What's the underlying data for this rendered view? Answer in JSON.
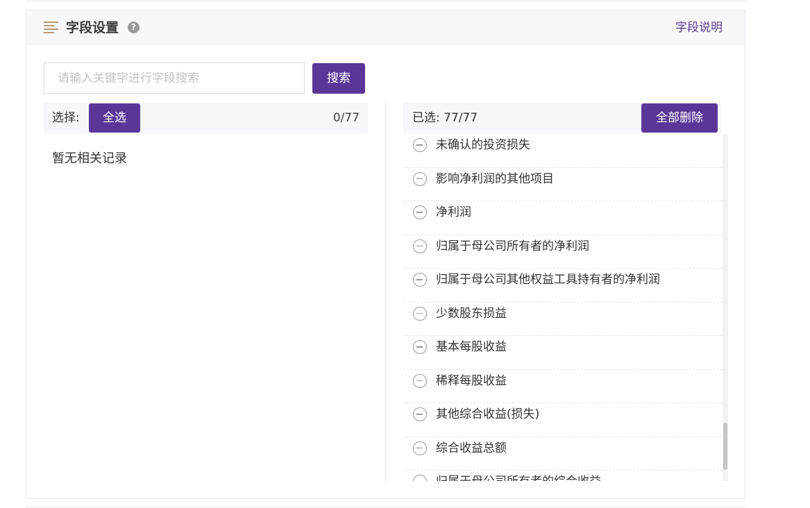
{
  "header": {
    "title": "字段设置",
    "help_glyph": "?",
    "link": "字段说明"
  },
  "search": {
    "placeholder": "请输入关键字进行字段搜索",
    "value": "",
    "button": "搜索"
  },
  "left_panel": {
    "label": "选择:",
    "select_all": "全选",
    "count": "0/77",
    "empty": "暂无相关记录"
  },
  "right_panel": {
    "label": "已选: 77/77",
    "delete_all": "全部删除",
    "items": [
      "未确认的投资损失",
      "影响净利润的其他项目",
      "净利润",
      "归属于母公司所有者的净利润",
      "归属于母公司其他权益工具持有者的净利润",
      "少数股东损益",
      "基本每股收益",
      "稀释每股收益",
      "其他综合收益(损失)",
      "综合收益总额",
      "归属于母公司所有者的综合收益"
    ]
  },
  "colors": {
    "accent": "#5b3699",
    "link": "#5b3a94",
    "header_icon": "#b89b78"
  },
  "icons": {
    "header": "list-lines-icon",
    "help": "question-circle-icon",
    "remove": "minus-circle-icon"
  }
}
